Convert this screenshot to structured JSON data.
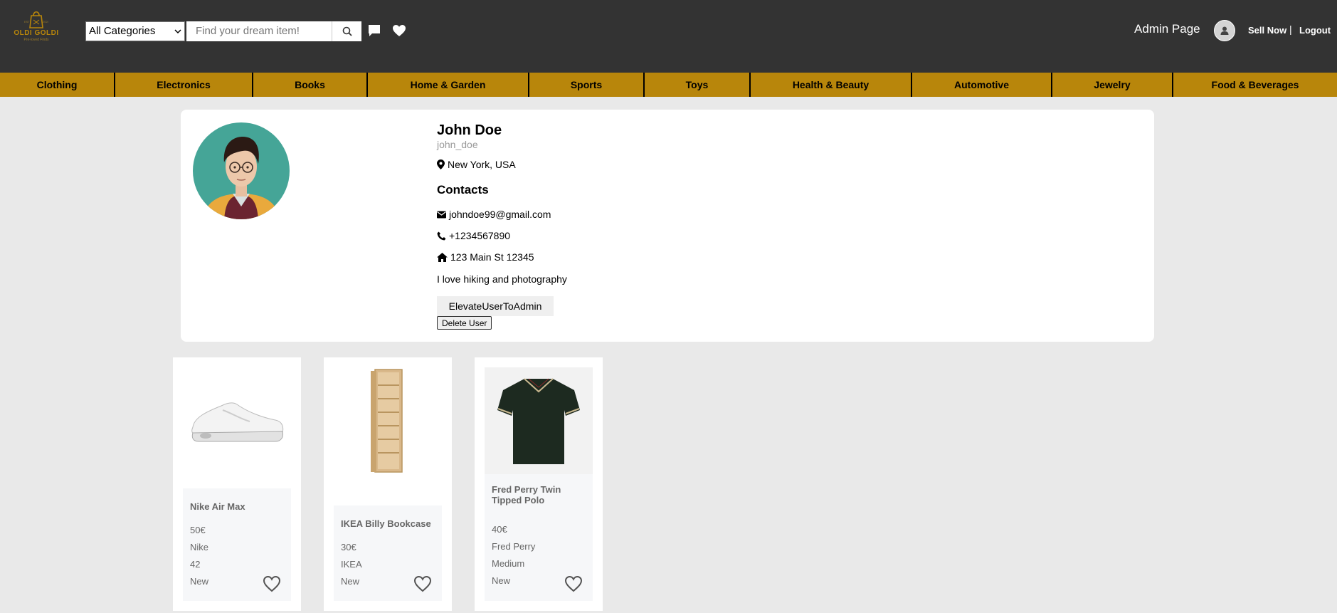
{
  "header": {
    "logo": {
      "brand": "OLDI GOLDI",
      "tagline": "Pre-loved Finds",
      "year_left": "EST",
      "year_right": "2024"
    },
    "category_select": {
      "selected": "All Categories"
    },
    "search": {
      "placeholder": "Find your dream item!"
    },
    "admin_link": "Admin Page",
    "sell_now": "Sell Now",
    "separator": "|",
    "logout": "Logout"
  },
  "categories": [
    "Clothing",
    "Electronics",
    "Books",
    "Home & Garden",
    "Sports",
    "Toys",
    "Health & Beauty",
    "Automotive",
    "Jewelry",
    "Food & Beverages"
  ],
  "profile": {
    "name": "John Doe",
    "username": "john_doe",
    "location": "New York, USA",
    "contacts_title": "Contacts",
    "email": "johndoe99@gmail.com",
    "phone": "+1234567890",
    "address": "123 Main St 12345",
    "bio": "I love hiking and photography",
    "elevate_label": "ElevateUserToAdmin",
    "delete_label": "Delete User"
  },
  "products": [
    {
      "title": "Nike Air Max",
      "price": "50€",
      "brand": "Nike",
      "size": "42",
      "condition": "New"
    },
    {
      "title": "IKEA Billy Bookcase",
      "price": "30€",
      "brand": "IKEA",
      "condition": "New"
    },
    {
      "title": "Fred Perry Twin Tipped Polo",
      "price": "40€",
      "brand": "Fred Perry",
      "size": "Medium",
      "condition": "New"
    }
  ],
  "colors": {
    "header_bg": "#333333",
    "accent_gold": "#b8860b",
    "page_bg": "#e9e9e9"
  }
}
